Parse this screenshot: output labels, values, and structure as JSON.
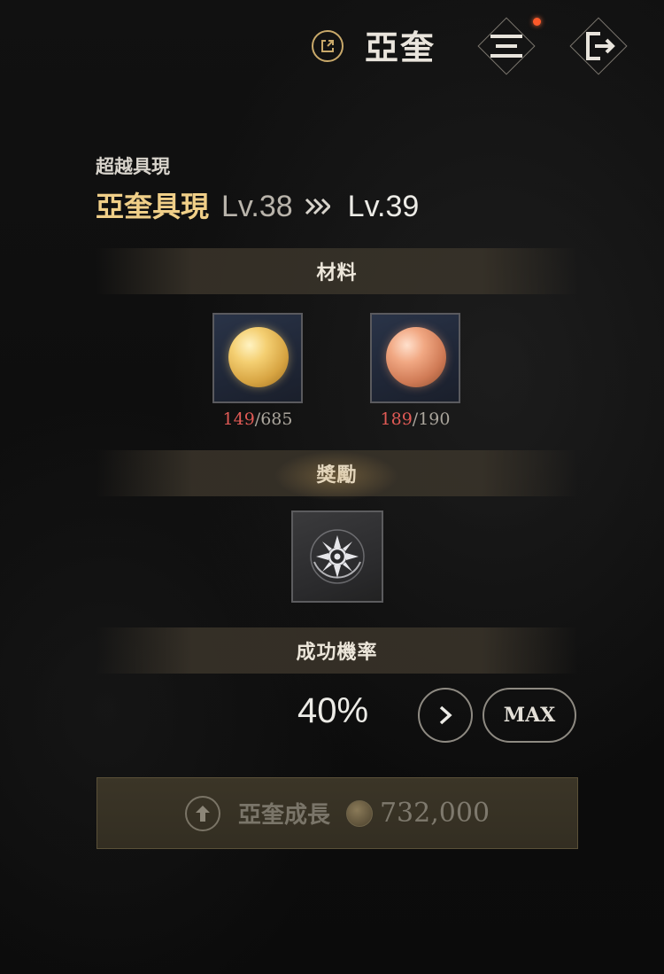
{
  "header": {
    "title": "亞奎",
    "icons": [
      "external-link-icon",
      "menu-icon",
      "exit-icon"
    ],
    "notification_color": "#ff5a2a"
  },
  "upgrade": {
    "subtitle": "超越具現",
    "item_name": "亞奎具現",
    "current_level": "Lv.38",
    "arrows": "»",
    "next_level": "Lv.39"
  },
  "sections": {
    "materials": "材料",
    "reward": "獎勵",
    "success_rate": "成功機率"
  },
  "materials": [
    {
      "name": "gold-yarn",
      "have": "149",
      "sep": "/",
      "need": "685"
    },
    {
      "name": "copper-yarn",
      "have": "189",
      "sep": "/",
      "need": "190"
    }
  ],
  "reward": {
    "icon": "sun-emblem-icon"
  },
  "rate": {
    "value": "40%",
    "max_label": "MAX"
  },
  "action": {
    "label": "亞奎成長",
    "cost": "732,000"
  },
  "colors": {
    "accent_gold": "#f0cf88",
    "insufficient": "#e05a55"
  }
}
